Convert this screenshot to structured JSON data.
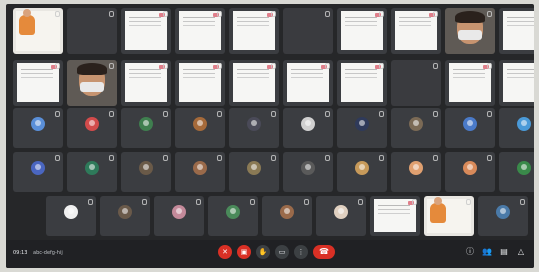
{
  "meeting": {
    "time": "09:13",
    "code": "abc-defg-hij"
  },
  "video_tiles_row0": [
    {
      "kind": "photo",
      "label": ""
    },
    {
      "kind": "dark",
      "label": ""
    },
    {
      "kind": "doc",
      "label": ""
    },
    {
      "kind": "doc",
      "label": ""
    },
    {
      "kind": "doc",
      "label": ""
    },
    {
      "kind": "dark",
      "label": ""
    },
    {
      "kind": "doc",
      "label": ""
    },
    {
      "kind": "doc",
      "label": ""
    },
    {
      "kind": "face",
      "label": ""
    },
    {
      "kind": "doc",
      "label": ""
    }
  ],
  "video_tiles_row1": [
    {
      "kind": "doc",
      "label": ""
    },
    {
      "kind": "face",
      "label": ""
    },
    {
      "kind": "doc",
      "label": ""
    },
    {
      "kind": "doc",
      "label": ""
    },
    {
      "kind": "doc",
      "label": ""
    },
    {
      "kind": "doc",
      "label": ""
    },
    {
      "kind": "doc",
      "label": ""
    },
    {
      "kind": "dark",
      "label": ""
    },
    {
      "kind": "doc",
      "label": ""
    },
    {
      "kind": "doc",
      "label": ""
    }
  ],
  "participants_row2": [
    {
      "color": "#5a8fd8"
    },
    {
      "color": "#d24b4b"
    },
    {
      "color": "#3f7f4f"
    },
    {
      "color": "#a56a3a"
    },
    {
      "color": "#4a4a58"
    },
    {
      "color": "#d0d0d0"
    },
    {
      "color": "#2f3a5a"
    },
    {
      "color": "#7b6a55"
    },
    {
      "color": "#4a7ac8"
    },
    {
      "color": "#4a9ad8"
    }
  ],
  "participants_row3": [
    {
      "color": "#4a66c0"
    },
    {
      "color": "#2e7a5a"
    },
    {
      "color": "#6a5a48"
    },
    {
      "color": "#9a6a4a"
    },
    {
      "color": "#8a7a55"
    },
    {
      "color": "#5a5a5a"
    },
    {
      "color": "#c79a5a"
    },
    {
      "color": "#e0a070"
    },
    {
      "color": "#d88a5a"
    },
    {
      "color": "#3a8a4a"
    }
  ],
  "participants_row4": [
    {
      "kind": "avatar",
      "color": "#f0f0f0"
    },
    {
      "kind": "avatar",
      "color": "#6a5a4a"
    },
    {
      "kind": "avatar",
      "color": "#c48a9a"
    },
    {
      "kind": "avatar",
      "color": "#4a8a5a"
    },
    {
      "kind": "avatar",
      "color": "#9a6a4a"
    },
    {
      "kind": "avatar",
      "color": "#e0d0c0"
    },
    {
      "kind": "doc"
    },
    {
      "kind": "photo"
    },
    {
      "kind": "avatar",
      "color": "#4a7aa8"
    }
  ],
  "controls": [
    {
      "icon": "mic-off-icon",
      "glyph": "✕",
      "variant": "red"
    },
    {
      "icon": "camera-off-icon",
      "glyph": "▣",
      "variant": "red"
    },
    {
      "icon": "hand-icon",
      "glyph": "✋",
      "variant": ""
    },
    {
      "icon": "present-icon",
      "glyph": "▭",
      "variant": ""
    },
    {
      "icon": "more-icon",
      "glyph": "⋮",
      "variant": ""
    },
    {
      "icon": "hangup-icon",
      "glyph": "☎",
      "variant": "hang"
    }
  ],
  "right_tools": [
    {
      "icon": "info-icon",
      "glyph": "ⓘ"
    },
    {
      "icon": "people-icon",
      "glyph": "👥"
    },
    {
      "icon": "chat-icon",
      "glyph": "▤"
    },
    {
      "icon": "activities-icon",
      "glyph": "△"
    }
  ]
}
